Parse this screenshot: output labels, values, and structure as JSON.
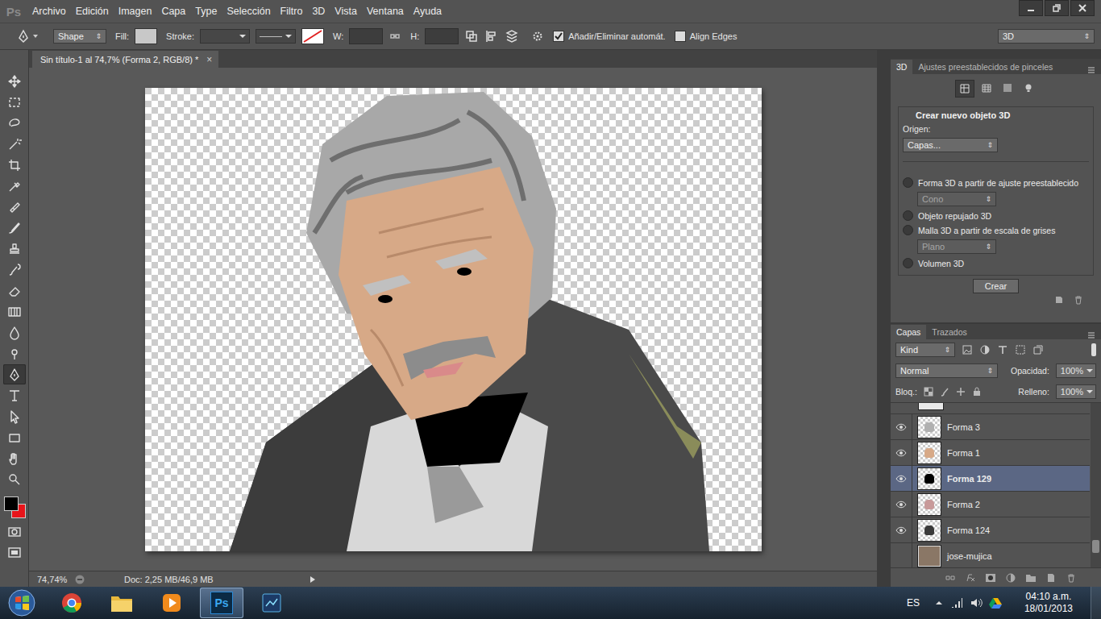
{
  "app": {
    "logo": "Ps"
  },
  "menu": [
    "Archivo",
    "Edición",
    "Imagen",
    "Capa",
    "Type",
    "Selección",
    "Filtro",
    "3D",
    "Vista",
    "Ventana",
    "Ayuda"
  ],
  "options_bar": {
    "mode": "Shape",
    "fill_label": "Fill:",
    "fill_color": "#c8c8c8",
    "stroke_label": "Stroke:",
    "width_label": "W:",
    "width_value": "",
    "height_label": "H:",
    "height_value": "",
    "checkboxes": [
      {
        "label": "Añadir/Eliminar automát.",
        "checked": true
      },
      {
        "label": "Align Edges",
        "checked": false
      }
    ],
    "workspace": "3D"
  },
  "tools": [
    {
      "selected": false
    },
    {
      "selected": false
    },
    {
      "selected": false
    },
    {
      "selected": false
    },
    {
      "selected": false
    },
    {
      "selected": false
    },
    {
      "selected": false
    },
    {
      "selected": false
    },
    {
      "selected": false
    },
    {
      "selected": false
    },
    {
      "selected": false
    },
    {
      "selected": false
    },
    {
      "selected": false
    },
    {
      "selected": false
    },
    {
      "selected": true
    },
    {
      "selected": false
    },
    {
      "selected": false
    },
    {
      "selected": false
    },
    {
      "selected": false
    },
    {
      "selected": false
    }
  ],
  "colors": {
    "foreground": "#000000",
    "background": "#e8141a"
  },
  "document": {
    "tab": "Sin título-1 al 74,7% (Forma 2, RGB/8) *",
    "close": "×",
    "zoom": "74,74%",
    "doc_info": "Doc: 2,25 MB/46,9 MB"
  },
  "panel_3d": {
    "tabs": [
      {
        "label": "3D",
        "selected": true
      },
      {
        "label": "Ajustes preestablecidos de pinceles",
        "selected": false
      }
    ],
    "title": "Crear nuevo objeto 3D",
    "origin_label": "Origen:",
    "origin_value": "Capas...",
    "options": [
      {
        "label": "Forma 3D a partir de ajuste preestablecido",
        "selected": false,
        "dropdown": {
          "value": "Cono",
          "disabled": true
        }
      },
      {
        "label": "Objeto repujado 3D",
        "selected": false
      },
      {
        "label": "Malla 3D a partir de escala de grises",
        "selected": false,
        "dropdown": {
          "value": "Plano",
          "disabled": true
        }
      },
      {
        "label": "Volumen 3D",
        "selected": false
      }
    ],
    "button": "Crear"
  },
  "layers_panel": {
    "tabs": [
      {
        "label": "Capas",
        "selected": true
      },
      {
        "label": "Trazados",
        "selected": false
      }
    ],
    "filter": "Kind",
    "blend_mode": "Normal",
    "opacity_label": "Opacidad:",
    "opacity": "100%",
    "lock_label": "Bloq.:",
    "fill_label": "Relleno:",
    "fill": "100%",
    "layers": [
      {
        "name": "Forma 3",
        "visible": true,
        "selected": false,
        "kind": "shape",
        "color": "#b0b0b0"
      },
      {
        "name": "Forma 1",
        "visible": true,
        "selected": false,
        "kind": "shape",
        "color": "#d7a987"
      },
      {
        "name": "Forma 129",
        "visible": true,
        "selected": true,
        "kind": "shape",
        "color": "#000000"
      },
      {
        "name": "Forma 2",
        "visible": true,
        "selected": false,
        "kind": "shape",
        "color": "#c89a9a"
      },
      {
        "name": "Forma 124",
        "visible": true,
        "selected": false,
        "kind": "shape",
        "color": "#3a3a3a"
      },
      {
        "name": "jose-mujica",
        "visible": false,
        "selected": false,
        "kind": "image",
        "color": "#8a7766"
      }
    ]
  },
  "taskbar": {
    "apps": [
      {
        "selected": false
      },
      {
        "selected": false
      },
      {
        "selected": false
      },
      {
        "selected": true
      },
      {
        "selected": false
      }
    ],
    "language": "ES",
    "time": "04:10 a.m.",
    "date": "18/01/2013"
  }
}
